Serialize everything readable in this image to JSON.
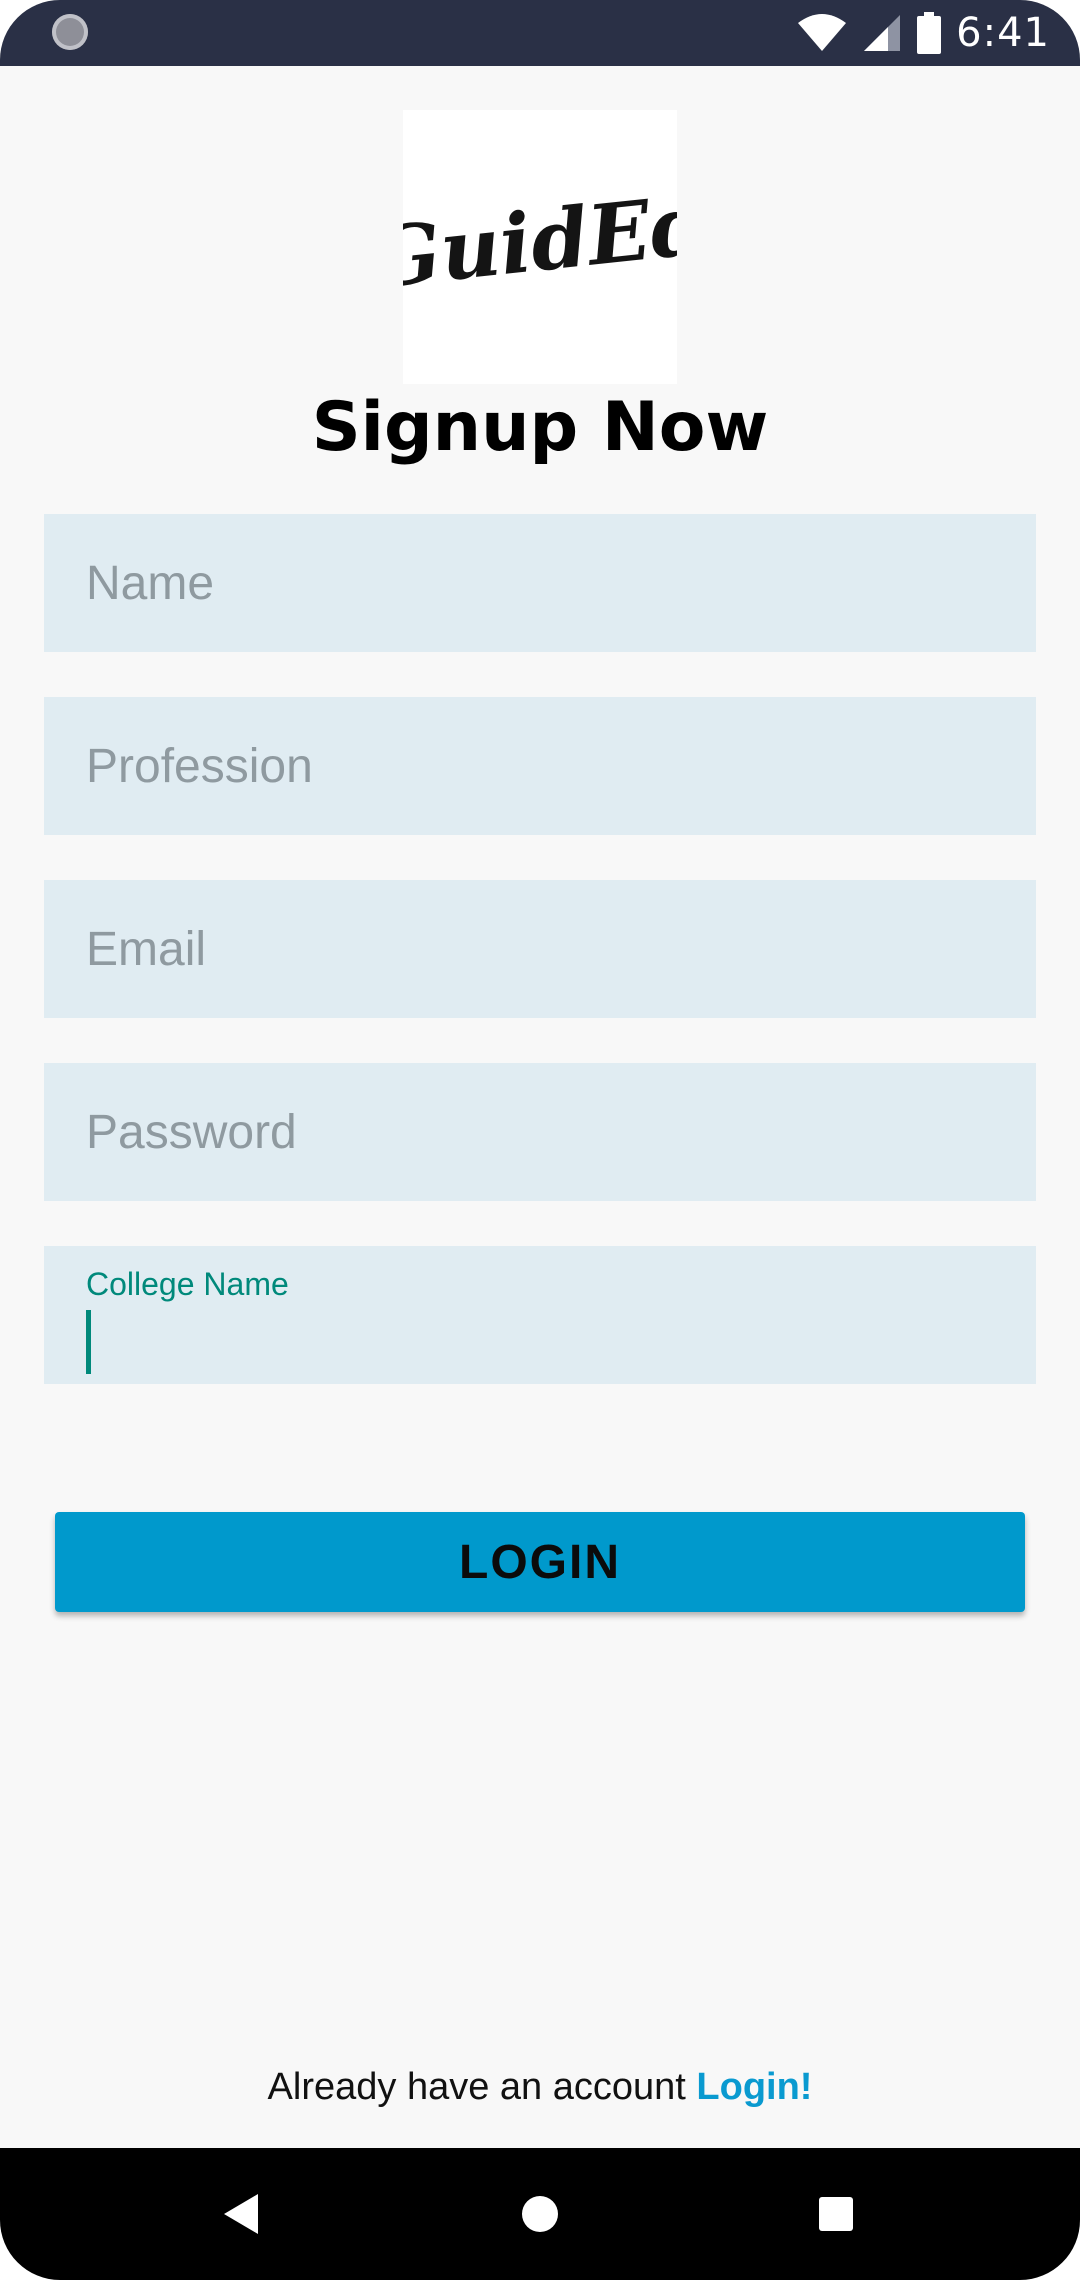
{
  "status_bar": {
    "time": "6:41",
    "icons": [
      "wifi-icon",
      "cell-signal-icon",
      "battery-icon"
    ]
  },
  "logo": {
    "text": "GuidEd"
  },
  "title": "Signup Now",
  "form": {
    "name_placeholder": "Name",
    "profession_placeholder": "Profession",
    "email_placeholder": "Email",
    "password_placeholder": "Password",
    "college_label": "College Name",
    "college_value": ""
  },
  "login_button": {
    "label": "LOGIN"
  },
  "footer": {
    "prompt": "Already have an account",
    "link": "Login!"
  },
  "colors": {
    "status_bar": "#2a3046",
    "field_bg": "#e0ecf2",
    "accent": "#0099cc",
    "focus": "#00897b"
  }
}
